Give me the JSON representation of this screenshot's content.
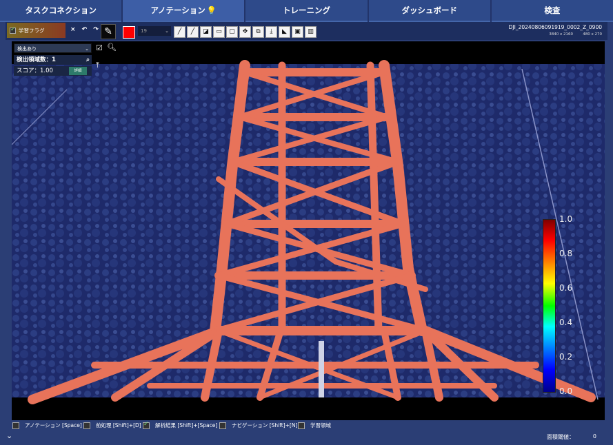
{
  "tabs": [
    {
      "label": "タスクコネクション"
    },
    {
      "label": "アノテーション"
    },
    {
      "label": "トレーニング"
    },
    {
      "label": "ダッシュボード"
    },
    {
      "label": "検査"
    }
  ],
  "active_tab": 1,
  "toolbar": {
    "learning_flag_label": "学習フラグ",
    "undo_redo": "× ↶ ↷",
    "brush_size": "19",
    "file_name": "DJI_20240806091919_0002_Z_0900",
    "image_resolution": "3840 x 2160",
    "display_resolution": "480 x 270",
    "brush_color": "#ff0000"
  },
  "panel": {
    "filter_value": "検出あり",
    "detect_count": "検出領域数：1",
    "score": "スコア：1.00",
    "detail_button": "詳細"
  },
  "colorbar": {
    "labels": [
      "1.0",
      "0.8",
      "0.6",
      "0.4",
      "0.2",
      "0.0"
    ]
  },
  "bottom": {
    "toggles": [
      {
        "label": "アノテーション [Space]",
        "checked": false
      },
      {
        "label": "前処理 [Shift]+[D]",
        "checked": false
      },
      {
        "label": "解析結果 [Shift]+[Space]",
        "checked": true
      },
      {
        "label": "ナビゲーション [Shift]+[N]",
        "checked": false
      },
      {
        "label": "学習領域",
        "checked": false
      }
    ],
    "area_threshold_label": "面積閾値：",
    "area_threshold_value": "0"
  },
  "colors": {
    "background": "#2b3e75",
    "heat_overlay": "#e8735a",
    "cold_overlay": "#1f2a6b"
  }
}
